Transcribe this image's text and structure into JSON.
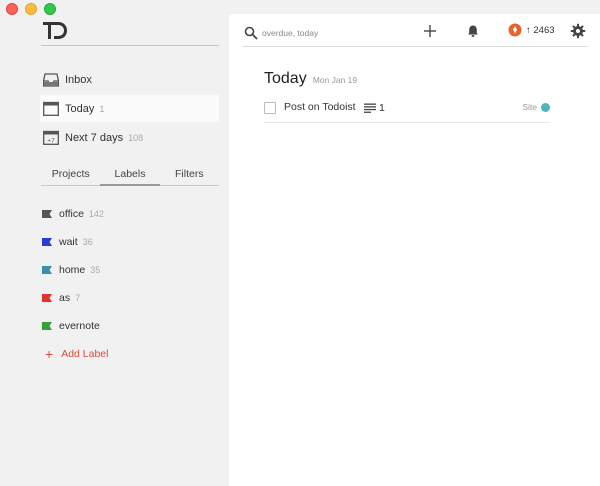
{
  "sidebar": {
    "nav": [
      {
        "label": "Inbox",
        "count": "",
        "icon": "inbox-icon"
      },
      {
        "label": "Today",
        "count": "1",
        "icon": "calendar-icon"
      },
      {
        "label": "Next 7 days",
        "count": "108",
        "icon": "calendar-plus7-icon",
        "icon_text": "+7"
      }
    ],
    "tabs": [
      {
        "label": "Projects"
      },
      {
        "label": "Labels",
        "active": true
      },
      {
        "label": "Filters"
      }
    ],
    "labels": [
      {
        "name": "office",
        "count": "142",
        "color": "#555555"
      },
      {
        "name": "wait",
        "count": "36",
        "color": "#2a3bd6"
      },
      {
        "name": "home",
        "count": "35",
        "color": "#3b8fa6"
      },
      {
        "name": "as",
        "count": "7",
        "color": "#e0332e"
      },
      {
        "name": "evernote",
        "count": "",
        "color": "#3a9e3a"
      }
    ],
    "add_label": "Add Label"
  },
  "toolbar": {
    "search_placeholder": "overdue, today",
    "karma": "↑ 2463",
    "karma_color": "#e8622b"
  },
  "view": {
    "title": "Today",
    "date": "Mon Jan 19"
  },
  "tasks": [
    {
      "content": "Post on Todoist",
      "notes_count": "1",
      "project": "Site",
      "project_color": "#4fb4c0"
    }
  ]
}
